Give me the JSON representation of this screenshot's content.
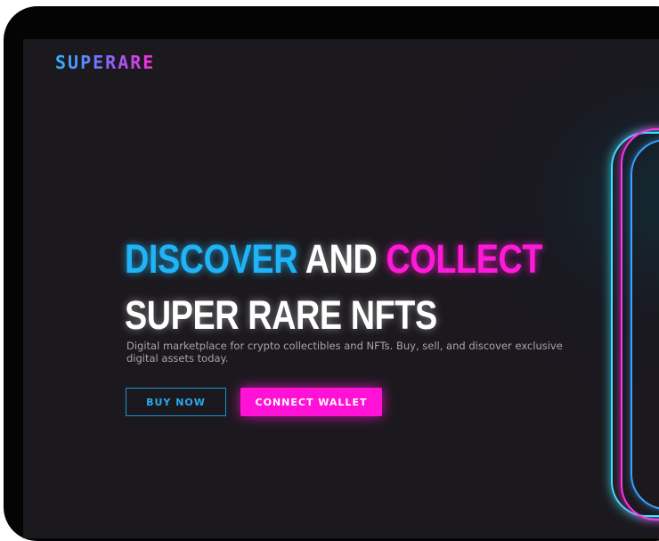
{
  "brand": {
    "logo_text": "SUPERARE"
  },
  "hero": {
    "title_word_1": "DISCOVER",
    "title_word_2": "AND",
    "title_word_3": "COLLECT",
    "title_line_2": "SUPER RARE NFTS",
    "description": "Digital marketplace for crypto collectibles and NFTs. Buy, sell, and discover exclusive digital assets today."
  },
  "actions": {
    "buy_now_label": "BUY NOW",
    "connect_wallet_label": "CONNECT WALLET"
  },
  "colors": {
    "background": "#1c191e",
    "accent_cyan": "#20b4f6",
    "accent_pink": "#ff1ad8",
    "text_white": "#ffffff",
    "text_muted": "#a7a5ab"
  }
}
